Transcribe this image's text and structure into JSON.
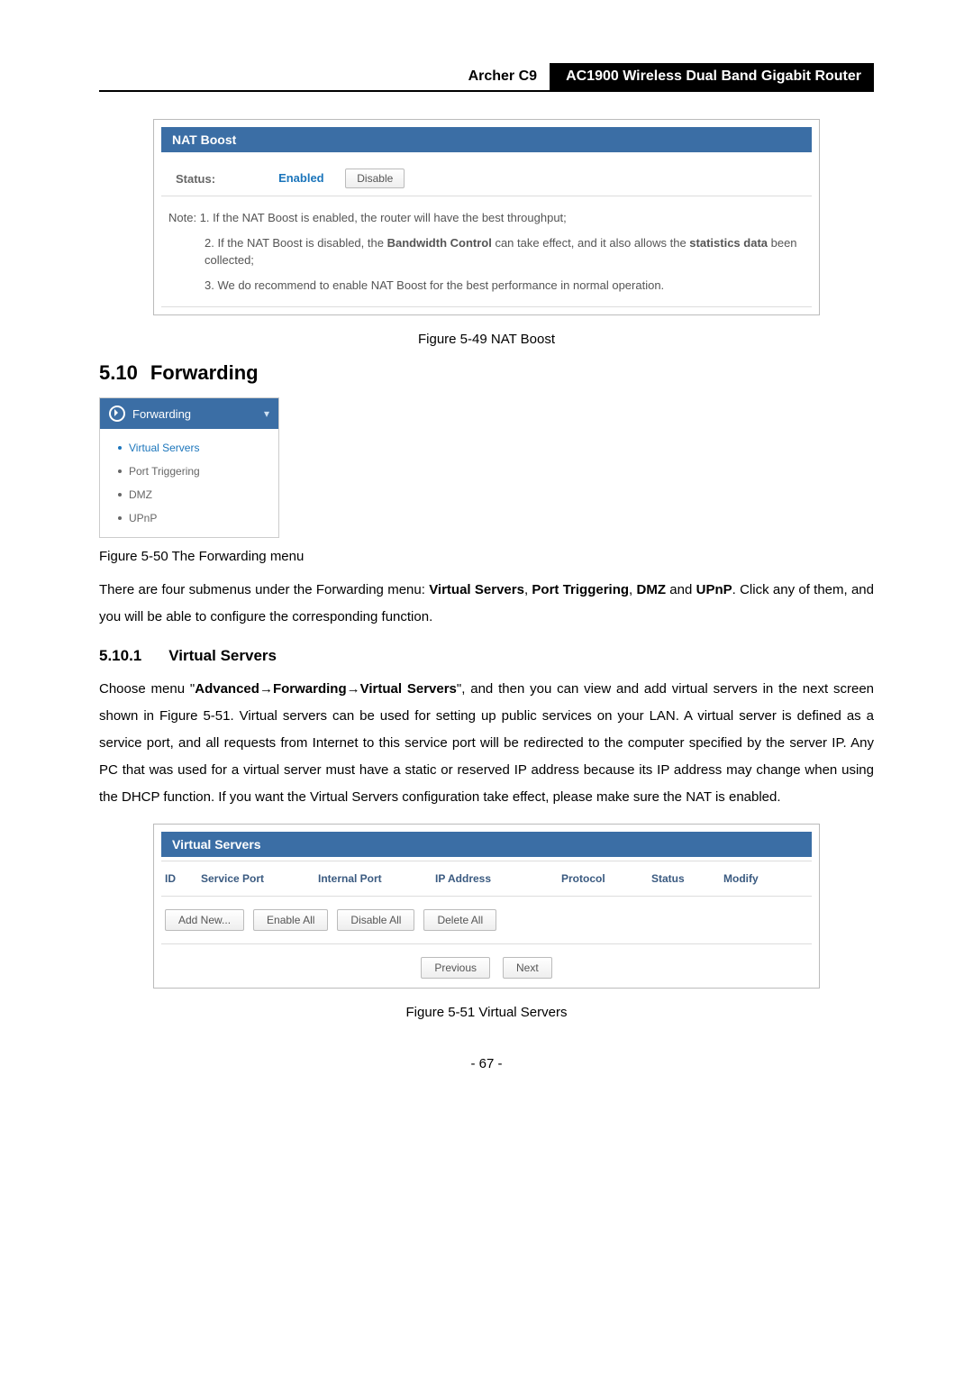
{
  "header": {
    "left": "Archer C9",
    "right": "AC1900 Wireless Dual Band Gigabit Router"
  },
  "nat": {
    "title": "NAT Boost",
    "status_label": "Status:",
    "enabled_label": "Enabled",
    "disable_btn": "Disable",
    "note_prefix": "Note: ",
    "note1": "1. If the NAT Boost is enabled, the router will have the best throughput;",
    "note2a": "2. If the NAT Boost is disabled, the ",
    "note2b": "Bandwidth Control",
    "note2c": " can take effect, and it also allows the ",
    "note2d": "statistics data",
    "note2e": " been collected;",
    "note3": "3. We do recommend to enable NAT Boost for the best performance in normal operation."
  },
  "fig49": "Figure 5-49 NAT Boost",
  "sec_forward": {
    "num": "5.10",
    "title": "Forwarding"
  },
  "fwd_menu": {
    "head": "Forwarding",
    "items": [
      "Virtual Servers",
      "Port Triggering",
      "DMZ",
      "UPnP"
    ]
  },
  "fig50": "Figure 5-50 The Forwarding menu",
  "p1a": "There are four submenus under the Forwarding menu: ",
  "p1b": "Virtual Servers",
  "p1c": ", ",
  "p1d": "Port Triggering",
  "p1e": ", ",
  "p1f": "DMZ",
  "p1g": " and ",
  "p1h": "UPnP",
  "p1i": ". Click any of them, and you will be able to configure the corresponding function.",
  "sub_vs": {
    "num": "5.10.1",
    "title": "Virtual Servers"
  },
  "p2a": "Choose menu \"",
  "p2b": "Advanced",
  "p2arr1": "→",
  "p2c": "Forwarding",
  "p2arr2": "→",
  "p2d": "Virtual Servers",
  "p2e": "\", and then you can view and add virtual servers in the next screen shown in Figure 5-51. Virtual servers can be used for setting up public services on your LAN. A virtual server is defined as a service port, and all requests from Internet to this service port will be redirected to the computer specified by the server IP. Any PC that was used for a virtual server must have a static or reserved IP address because its IP address may change when using the DHCP function. If you want the Virtual Servers configuration take effect, please make sure the NAT is enabled.",
  "vs": {
    "title": "Virtual Servers",
    "cols": {
      "id": "ID",
      "sp": "Service Port",
      "ip": "Internal Port",
      "ipa": "IP Address",
      "pr": "Protocol",
      "st": "Status",
      "md": "Modify"
    },
    "btns": {
      "add": "Add New...",
      "en": "Enable All",
      "dis": "Disable All",
      "del": "Delete All",
      "prev": "Previous",
      "next": "Next"
    }
  },
  "fig51": "Figure 5-51 Virtual Servers",
  "page_num": "- 67 -"
}
